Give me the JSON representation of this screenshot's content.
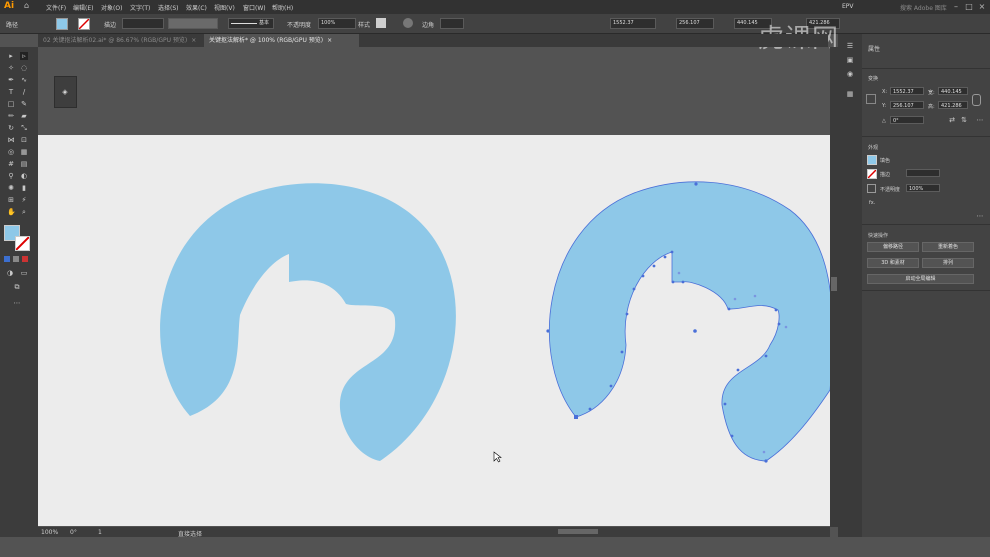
{
  "app": {
    "logo": "Ai",
    "menu": [
      "文件(F)",
      "编辑(E)",
      "对象(O)",
      "文字(T)",
      "选择(S)",
      "效果(C)",
      "视图(V)",
      "窗口(W)",
      "帮助(H)"
    ],
    "workspace": "EPV",
    "search_placeholder": "搜索 Adobe 图库",
    "watermark": "虎课网"
  },
  "controlbar": {
    "label_path": "路径",
    "label_stroke": "描边",
    "stroke_profile": "基本",
    "label_opacity": "不透明度",
    "opacity_value": "100%",
    "label_style": "样式",
    "label_anchor": "边角",
    "x_value": "1552.37",
    "y_value": "256.107",
    "w_value": "440.145",
    "h_value": "421.286",
    "fill_color": "#8ec8e8"
  },
  "tabs": [
    {
      "label": "02 关键抠法解析02.ai* @ 86.67% (RGB/GPU 预览)",
      "close": "×",
      "active": false
    },
    {
      "label": "关键抠法解析* @ 100% (RGB/GPU 预览)",
      "close": "×",
      "active": true
    }
  ],
  "statusbar": {
    "zoom": "100%",
    "angle": "0°",
    "page": "1",
    "tool_name": "直接选择"
  },
  "properties": {
    "title": "属性",
    "section_transform": "变换",
    "x_label": "X:",
    "x_value": "1552.37",
    "y_label": "Y:",
    "y_value": "256.107",
    "w_label": "宽:",
    "w_value": "440.145",
    "h_label": "高:",
    "h_value": "421.286",
    "angle_label": "△",
    "angle_value": "0°",
    "section_appearance": "外观",
    "fill_label": "填色",
    "stroke_label": "描边",
    "opacity_label": "不透明度",
    "opacity_value": "100%",
    "fx_label": "fx.",
    "section_quick": "快速操作",
    "btn_offset": "偏移路径",
    "btn_recolor": "重新着色",
    "btn_3d": "3D 和素材",
    "btn_arrange": "排列",
    "btn_autotrace": "启动全局编辑"
  },
  "colors": {
    "shape_fill": "#8ec8e8",
    "artboard": "#ececec",
    "pasteboard": "#535353",
    "selection": "#4a6fd8"
  }
}
